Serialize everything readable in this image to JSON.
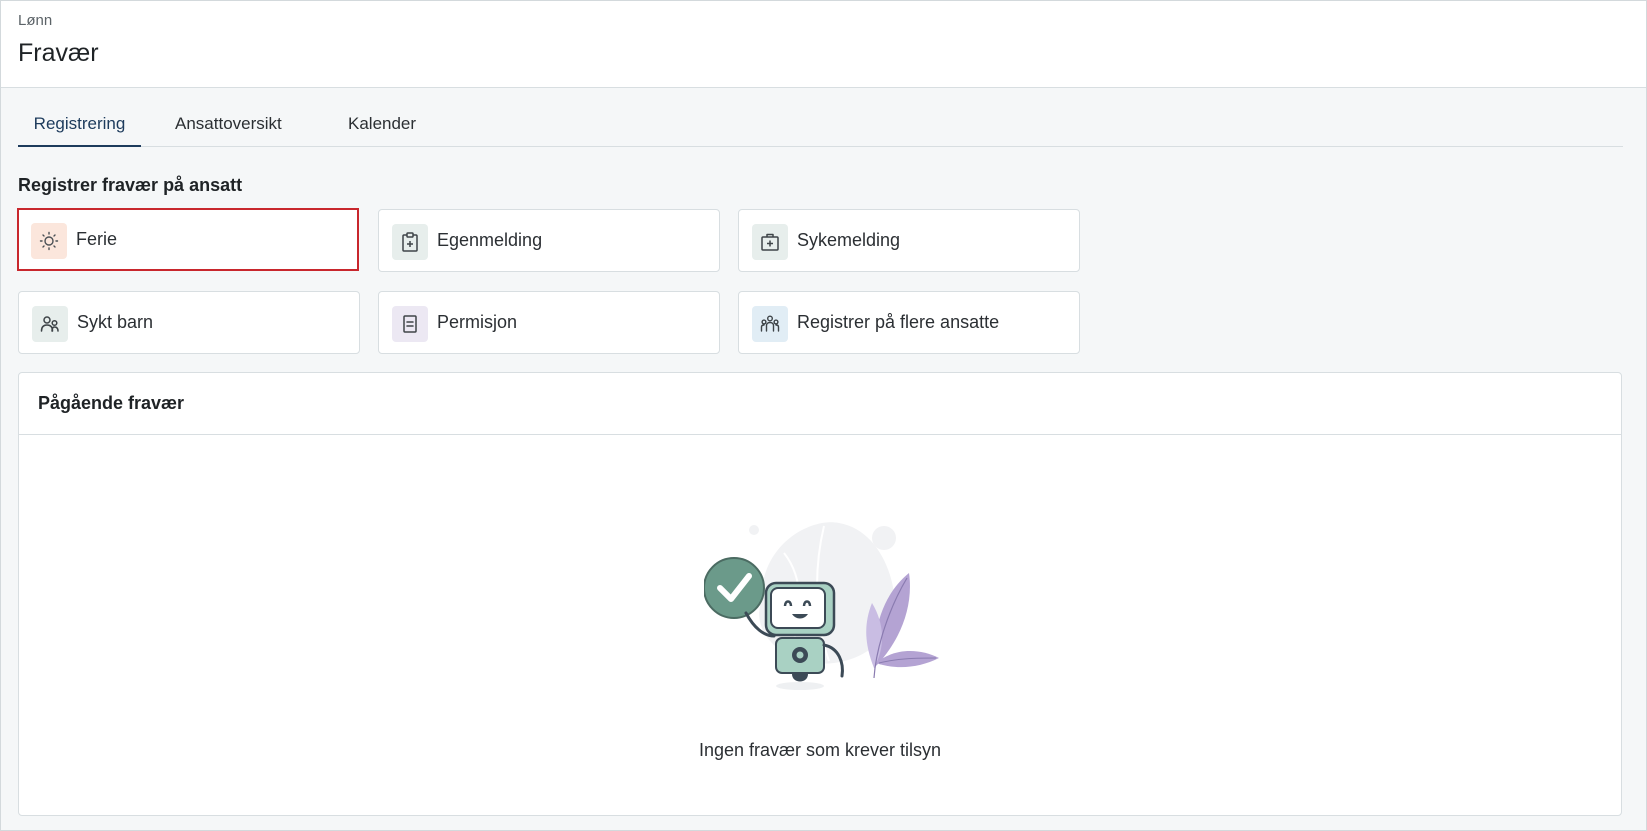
{
  "header": {
    "breadcrumb": "Lønn",
    "title": "Fravær"
  },
  "tabs": [
    {
      "label": "Registrering",
      "active": true
    },
    {
      "label": "Ansattoversikt",
      "active": false
    },
    {
      "label": "Kalender",
      "active": false
    }
  ],
  "register_section": {
    "title": "Registrer fravær på ansatt",
    "options": [
      {
        "label": "Ferie",
        "icon": "sun-icon",
        "icon_bg": "#fbe6dc",
        "selected": true
      },
      {
        "label": "Egenmelding",
        "icon": "clipboard-plus-icon",
        "icon_bg": "#e7eeec",
        "selected": false
      },
      {
        "label": "Sykemelding",
        "icon": "medical-case-icon",
        "icon_bg": "#e7eeec",
        "selected": false
      },
      {
        "label": "Sykt barn",
        "icon": "people-icon",
        "icon_bg": "#e7eeec",
        "selected": false
      },
      {
        "label": "Permisjon",
        "icon": "document-icon",
        "icon_bg": "#ece8f3",
        "selected": false
      },
      {
        "label": "Registrer på flere ansatte",
        "icon": "group-icon",
        "icon_bg": "#e1edf5",
        "selected": false
      }
    ]
  },
  "ongoing": {
    "title": "Pågående fravær",
    "empty_message": "Ingen fravær som krever tilsyn"
  },
  "colors": {
    "accent": "#1d3b5c",
    "selected_border": "#c8272d",
    "check_green": "#6b9a8a",
    "leaf_purple": "#b4a3d3"
  }
}
